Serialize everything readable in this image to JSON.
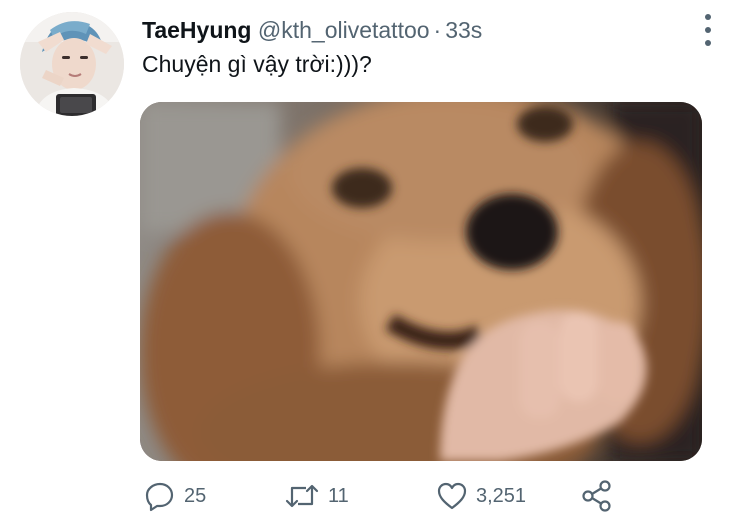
{
  "tweet": {
    "author": {
      "display_name": "TaeHyung",
      "handle": "@kth_olivetattoo"
    },
    "separator": "·",
    "time": "33s",
    "text": "Chuyện gì vậy trời:)))?",
    "media": {
      "description_icon": "photo-dog"
    },
    "actions": {
      "reply_count": "25",
      "retweet_count": "11",
      "like_count": "3,251"
    },
    "icons": {
      "reply": "speech-bubble-icon",
      "retweet": "retweet-icon",
      "like": "heart-icon",
      "share": "share-icon",
      "more": "more-vertical-icon"
    },
    "colors": {
      "muted": "#536471",
      "text": "#0f1419"
    }
  }
}
